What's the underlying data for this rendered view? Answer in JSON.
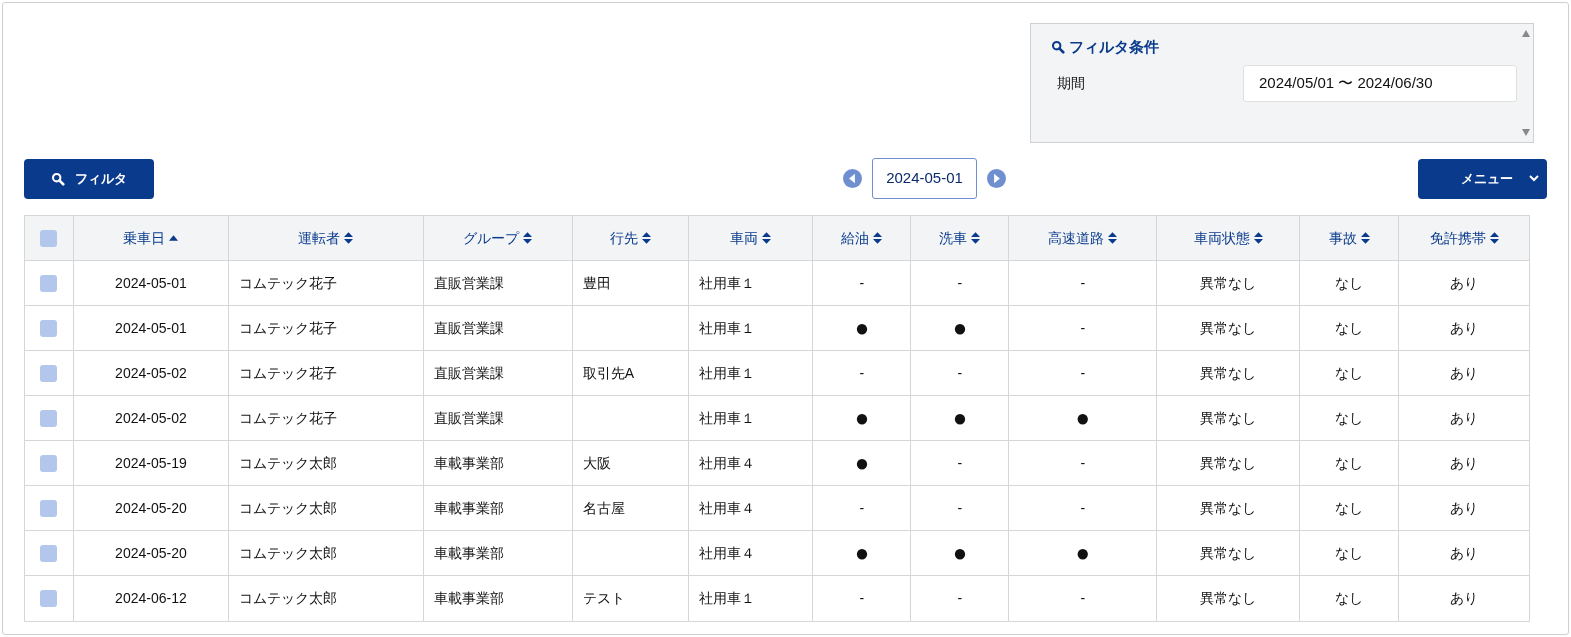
{
  "filter_panel": {
    "title": "フィルタ条件",
    "fields": [
      {
        "label": "期間",
        "value": "2024/05/01 〜 2024/06/30"
      }
    ]
  },
  "toolbar": {
    "filter_button": "フィルタ",
    "date": "2024-05-01",
    "menu_button": "メニュー"
  },
  "table": {
    "select_all": {
      "checked": false
    },
    "columns": [
      {
        "label": "乗車日",
        "sorted": true
      },
      {
        "label": "運転者",
        "sorted": false
      },
      {
        "label": "グループ",
        "sorted": false
      },
      {
        "label": "行先",
        "sorted": false
      },
      {
        "label": "車両",
        "sorted": false
      },
      {
        "label": "給油",
        "sorted": false
      },
      {
        "label": "洗車",
        "sorted": false
      },
      {
        "label": "高速道路",
        "sorted": false
      },
      {
        "label": "車両状態",
        "sorted": false
      },
      {
        "label": "事故",
        "sorted": false
      },
      {
        "label": "免許携帯",
        "sorted": false
      }
    ],
    "rows": [
      {
        "checked": false,
        "cells": [
          "2024-05-01",
          "コムテック花子",
          "直販営業課",
          "豊田",
          "社用車１",
          "-",
          "-",
          "-",
          "異常なし",
          "なし",
          "あり"
        ]
      },
      {
        "checked": false,
        "cells": [
          "2024-05-01",
          "コムテック花子",
          "直販営業課",
          "",
          "社用車１",
          "●",
          "●",
          "-",
          "異常なし",
          "なし",
          "あり"
        ]
      },
      {
        "checked": false,
        "cells": [
          "2024-05-02",
          "コムテック花子",
          "直販営業課",
          "取引先A",
          "社用車１",
          "-",
          "-",
          "-",
          "異常なし",
          "なし",
          "あり"
        ]
      },
      {
        "checked": false,
        "cells": [
          "2024-05-02",
          "コムテック花子",
          "直販営業課",
          "",
          "社用車１",
          "●",
          "●",
          "●",
          "異常なし",
          "なし",
          "あり"
        ]
      },
      {
        "checked": false,
        "cells": [
          "2024-05-19",
          "コムテック太郎",
          "車載事業部",
          "大阪",
          "社用車４",
          "●",
          "-",
          "-",
          "異常なし",
          "なし",
          "あり"
        ]
      },
      {
        "checked": false,
        "cells": [
          "2024-05-20",
          "コムテック太郎",
          "車載事業部",
          "名古屋",
          "社用車４",
          "-",
          "-",
          "-",
          "異常なし",
          "なし",
          "あり"
        ]
      },
      {
        "checked": false,
        "cells": [
          "2024-05-20",
          "コムテック太郎",
          "車載事業部",
          "",
          "社用車４",
          "●",
          "●",
          "●",
          "異常なし",
          "なし",
          "あり"
        ]
      },
      {
        "checked": false,
        "cells": [
          "2024-06-12",
          "コムテック太郎",
          "車載事業部",
          "テスト",
          "社用車１",
          "-",
          "-",
          "-",
          "異常なし",
          "なし",
          "あり"
        ]
      }
    ]
  }
}
